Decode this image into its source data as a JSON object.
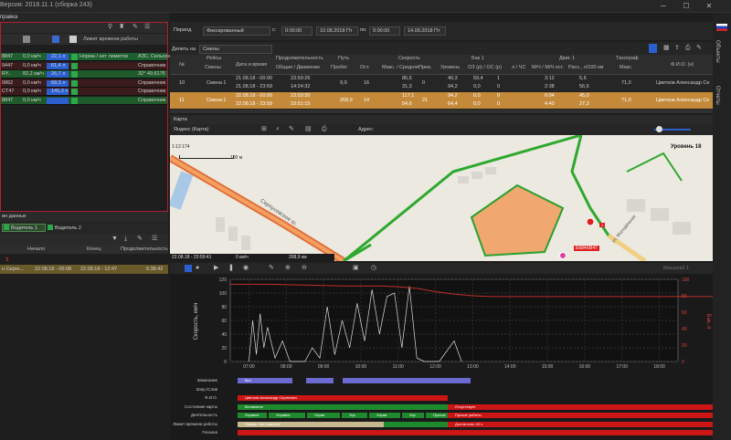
{
  "titlebar": {
    "title": "Версия: 2018.11.1 (сборка 243)"
  },
  "menu": {
    "help": "правка"
  },
  "left_top": {
    "limit_header": "Лимит времени работы",
    "rows": [
      {
        "id": "8847",
        "speed": "0,0 км/ч",
        "val": "22,1 л",
        "norm": "Норма / нет лимитов",
        "loc": "АЗС, Сельхоз"
      },
      {
        "id": "9447",
        "speed": "0,0 км/ч",
        "val": "61,4 л",
        "loc": "Справочник"
      },
      {
        "id": "RY..",
        "speed": "82,2 км/ч",
        "val": "26,7 л",
        "loc": "32° 49,6176"
      },
      {
        "id": "0862",
        "speed": "0,0 км/ч",
        "val": "68,3 л",
        "loc": "Справочник"
      },
      {
        "id": "CT47",
        "speed": "0,0 км/ч",
        "val": "145,3 л",
        "loc": "Справочник"
      },
      {
        "id": "8847",
        "speed": "0,0 км/ч",
        "val": "",
        "loc": "Справочник"
      }
    ]
  },
  "left_bottom": {
    "section_title": "ин данных",
    "driver1": "Водитель 1",
    "driver2": "Водитель 2",
    "cols": [
      "Начало",
      "Конец",
      "Продолжительность"
    ],
    "row": {
      "name": "н Серге...",
      "start": "22.08.18 - 06:08",
      "end": "22.08.18 - 12:47",
      "dur": "6:38:42"
    },
    "marker": "3"
  },
  "period": {
    "label": "Период",
    "mode": "Фиксированный",
    "from_label": "с:",
    "from_time": "0:00:00",
    "from_date": "10.08.2018 Пт",
    "to_label": "по:",
    "to_time": "0:00:00",
    "to_date": "14.09.2018 Пт",
    "split_label": "Делить на",
    "split_value": "Смены"
  },
  "table": {
    "headers": {
      "n": "№",
      "trips": "Рейсы",
      "trips_sub": "Смены",
      "dt": "Дата и время",
      "duration": "Продолжительность",
      "duration_sub": "Общая / Движение",
      "path": "Путь",
      "mileage": "Пробег",
      "stops": "Ост.",
      "speed": "Скорость",
      "max": "Макс. / Средняя",
      "over": "Прев.",
      "tank": "Бак 1",
      "level": "Уровень",
      "oz": "ОЗ (р) / ОС (р)",
      "lh": "л / ЧС",
      "engine": "Двиг. 1",
      "mh": "М/Ч / М/Ч ост.",
      "cons": "Расх., л/100 км",
      "tacho": "Тахограф",
      "tmax": "Макс.",
      "fio": "Ф.И.О. (н)"
    },
    "rows": [
      {
        "n": "10",
        "shift": "Смена 1",
        "dt1": "21.08.18 - 00:00",
        "dt2": "21.08.18 - 23:59",
        "d1": "23:59:26",
        "d2": "14:24:32",
        "mil": "9,9",
        "stops": "16",
        "max": "86,5",
        "avg": "31,3",
        "over": "0",
        "lvl1": "40,3",
        "lvl2": "94,2",
        "oz": "59,4",
        "oc": "0,0",
        "lh1": "1",
        "lh2": "0",
        "mh1": "3:12",
        "mh2": "2:38",
        "c1": "5,6",
        "c2": "56,6",
        "tmax": "71,0",
        "fio": "Цветков Александр Се"
      },
      {
        "n": "11",
        "shift": "Смена 1",
        "dt1": "22.08.18 - 00:00",
        "dt2": "22.08.18 - 23:59",
        "d1": "23:59:30",
        "d2": "10:51:15",
        "mil": "268,9",
        "stops": "14",
        "max": "117,1",
        "avg": "54,6",
        "over": "21",
        "lvl1": "94,2",
        "lvl2": "64,4",
        "oz": "0,0",
        "oc": "0,0",
        "lh1": "0",
        "lh2": "0",
        "mh1": "6:04",
        "mh2": "4:40",
        "c1": "45,0",
        "c2": "27,3",
        "tmax": "71,0",
        "fio": "Цветков Александр Се"
      }
    ]
  },
  "map": {
    "tab": "Карта",
    "provider": "Яндекс (Карта)",
    "address_label": "Адрес:",
    "scale_ratio": "1:13 174",
    "scale_dist": "100 м",
    "level": "Уровень 18",
    "road_label": "Серпуховское ш.",
    "street_label": "ул. Молодёжная",
    "vehicle_tag": "Е684ХВ47",
    "status_dt": "22.08.18 - 23:59:41",
    "status_speed": "0 км/ч",
    "status_mil": "268,9 км",
    "small_tag": "1"
  },
  "chart_toolbar": {
    "scale_label": "Масштаб 1"
  },
  "chart_data": {
    "type": "line",
    "title": "",
    "xlabel": "",
    "ylabel": "Скорость, км/ч",
    "ylabel_right": "Бак, л",
    "ylim": [
      0,
      120
    ],
    "ylim_right": [
      0,
      100
    ],
    "yticks": [
      0,
      20,
      40,
      60,
      80,
      100,
      120
    ],
    "yticks_right": [
      0,
      20,
      40,
      60,
      80,
      100
    ],
    "xticks": [
      "07:00",
      "08:00",
      "09:00",
      "10:00",
      "11:00",
      "12:00",
      "13:00",
      "14:00",
      "15:00",
      "16:00",
      "17:00",
      "18:00"
    ],
    "series": [
      {
        "color": "#dcdcdc",
        "x": [
          0.5,
          0.6,
          0.7,
          0.8,
          0.9,
          1.0,
          1.2,
          1.4,
          1.6,
          1.8,
          2.0,
          2.2,
          2.4,
          2.6,
          2.8,
          3.0,
          3.2,
          3.4,
          3.6,
          3.8,
          4.0,
          4.2,
          4.4,
          4.6,
          4.8,
          5.0,
          5.2,
          5.4,
          5.6,
          5.8,
          6.0,
          6.2
        ],
        "values": [
          0,
          60,
          10,
          70,
          20,
          50,
          5,
          30,
          0,
          0,
          0,
          20,
          5,
          80,
          10,
          60,
          20,
          85,
          30,
          105,
          40,
          95,
          100,
          20,
          110,
          5,
          0,
          0,
          0,
          15,
          30,
          0
        ]
      },
      {
        "color": "#c0302a",
        "x": [
          0,
          1,
          2,
          3,
          4,
          4.5,
          5,
          5.5,
          6,
          6.5,
          7,
          8,
          9,
          10,
          11,
          12,
          13,
          14,
          15,
          16,
          17,
          18
        ],
        "values": [
          94,
          94,
          93,
          92,
          92,
          91,
          89,
          85,
          82,
          80,
          79,
          79,
          79,
          79,
          79,
          79,
          79,
          79,
          79,
          79,
          79,
          79
        ]
      }
    ]
  },
  "timeline": {
    "rows": [
      {
        "label": "Зажигание",
        "text": "Вкл"
      },
      {
        "label": "Запр./Слив",
        "text": ""
      },
      {
        "label": "Ф.И.О.",
        "text": "Цветков Александр Сергеевич"
      },
      {
        "label": "Состояние карты",
        "text": "Вставлена",
        "text2": "Отсутствует"
      },
      {
        "label": "Деятельность",
        "text": "Управлени",
        "text2": "Прочие работы"
      },
      {
        "label": "Лимит времени работы",
        "text": "Норма / нет лимитов",
        "text2": "Достаточно 43 ч"
      },
      {
        "label": "Геозона",
        "text": ""
      }
    ],
    "seg_labels": [
      "Управле",
      "Управле",
      "Управ",
      "Упр",
      "Управ",
      "Упр",
      "Прочие"
    ]
  },
  "right_sidebar": {
    "item1": "Объекты",
    "item2": "Отчеты"
  },
  "colors": {
    "orange_sel": "#c48a3a",
    "green": "#1e8a2e",
    "red": "#cc1515",
    "blue": "#2b5fd0",
    "purple": "#7a7acc",
    "beige": "#c8b890"
  }
}
